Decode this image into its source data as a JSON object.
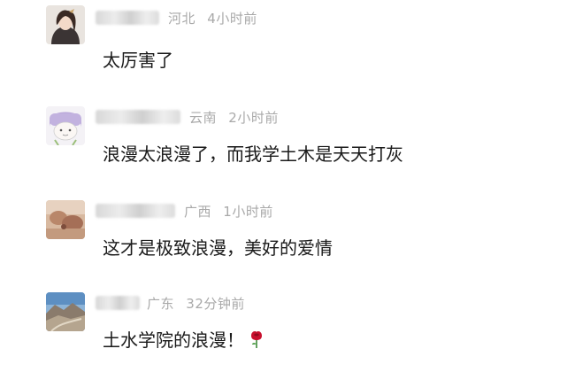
{
  "comments": [
    {
      "location": "河北",
      "time": "4小时前",
      "text": "太厉害了",
      "avatar_icon": "woman-portrait-icon"
    },
    {
      "location": "云南",
      "time": "2小时前",
      "text": "浪漫太浪漫了，而我学土木是天天打灰",
      "avatar_icon": "cartoon-girl-icon"
    },
    {
      "location": "广西",
      "time": "1小时前",
      "text": "这才是极致浪漫，美好的爱情",
      "avatar_icon": "landscape-photo-icon"
    },
    {
      "location": "广东",
      "time": "32分钟前",
      "text": "土水学院的浪漫！",
      "avatar_icon": "mountain-road-icon",
      "emoji_icon": "rose-icon"
    }
  ],
  "colors": {
    "meta_text": "#a9a9a9",
    "body_text": "#1a1a1a",
    "background": "#ffffff",
    "rose": "#c8102e"
  }
}
